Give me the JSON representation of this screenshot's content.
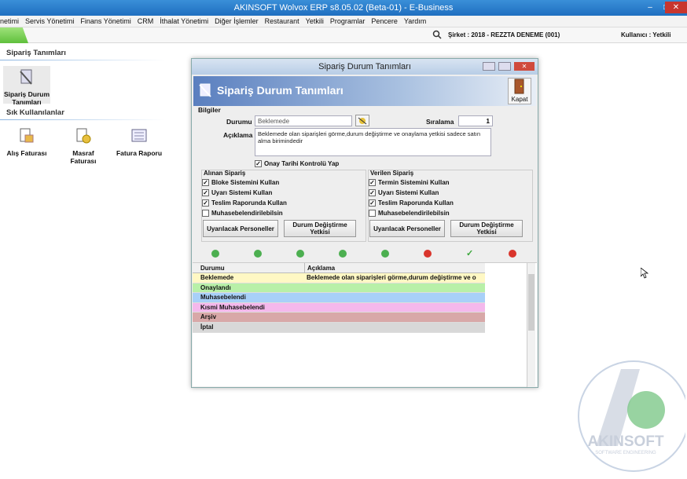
{
  "app_title": "AKINSOFT Wolvox ERP s8.05.02 (Beta-01) - E-Business",
  "menu": [
    "netimi",
    "Servis Yönetimi",
    "Finans Yönetimi",
    "CRM",
    "İthalat Yönetimi",
    "Diğer İşlemler",
    "Restaurant",
    "Yetkili",
    "Programlar",
    "Pencere",
    "Yardım"
  ],
  "status": {
    "sirket": "Şirket : 2018 - REZZTA DENEME (001)",
    "kullanici": "Kullanıcı : Yetkili"
  },
  "left": {
    "section1": "Sipariş Tanımları",
    "item1": "Sipariş Durum Tanımları",
    "section2": "Sık Kullanılanlar",
    "shortcuts": [
      "Alış Faturası",
      "Masraf Faturası",
      "Fatura Raporu"
    ]
  },
  "dialog": {
    "window_title": "Sipariş Durum Tanımları",
    "header": "Sipariş Durum Tanımları",
    "kapat": "Kapat",
    "bilgiler": "Bilgiler",
    "durumu_label": "Durumu",
    "durumu_value": "Beklemede",
    "siralama_label": "Sıralama",
    "siralama_value": "1",
    "aciklama_label": "Açıklama",
    "aciklama_value": "Beklemede olan siparişleri görme,durum değiştirme ve onaylama yetkisi sadece satın alma birimindedir",
    "onay": "Onay Tarihi Kontrolü Yap",
    "alinan_title": "Alınan Sipariş",
    "alinan": [
      "Bloke Sistemini Kullan",
      "Uyarı Sistemi Kullan",
      "Teslim Raporunda Kullan",
      "Muhasebelendirilebilsin"
    ],
    "alinan_checked": [
      true,
      true,
      true,
      false
    ],
    "verilen_title": "Verilen Sipariş",
    "verilen": [
      "Termin Sistemini Kullan",
      "Uyarı Sistemi Kullan",
      "Teslim Raporunda Kullan",
      "Muhasebelendirilebilsin"
    ],
    "verilen_checked": [
      true,
      true,
      true,
      false
    ],
    "btn_uyar": "Uyarılacak Personeller",
    "btn_durum1": "Durum Değiştirme",
    "btn_durum2": "Yetkisi",
    "grid_headers": [
      "Durumu",
      "Açıklama"
    ],
    "rows": [
      {
        "d": "Beklemede",
        "a": "Beklemede olan siparişleri görme,durum değiştirme ve o",
        "color": "#fff8c4"
      },
      {
        "d": "Onaylandı",
        "a": "",
        "color": "#b8f0a8"
      },
      {
        "d": "Muhasebelendi",
        "a": "",
        "color": "#a8d0f8"
      },
      {
        "d": "Kısmi Muhasebelendi",
        "a": "",
        "color": "#f4b8ec"
      },
      {
        "d": "Arşiv",
        "a": "",
        "color": "#d8a8a8"
      },
      {
        "d": "İptal",
        "a": "",
        "color": "#d8d8d8"
      }
    ]
  },
  "logo": {
    "brand": "AKINSOFT",
    "sub": "SOFTWARE ENGINEERING"
  }
}
